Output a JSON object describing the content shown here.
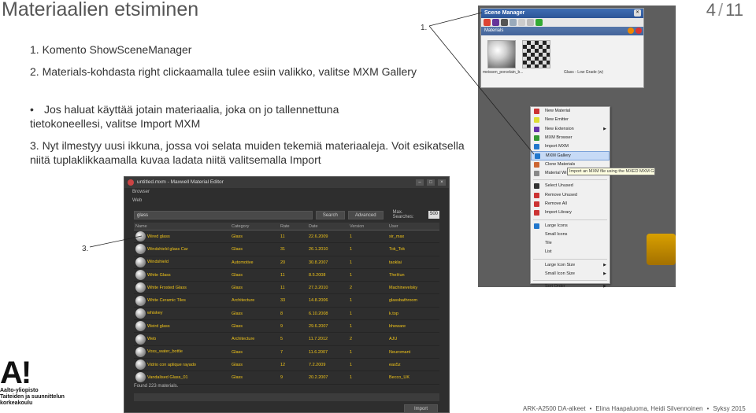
{
  "slide": {
    "title": "Materiaalien etsiminen",
    "page_current": "4",
    "page_total": "11",
    "step1": "1. Komento ShowSceneManager",
    "step2": "2. Materials-kohdasta right clickaamalla tulee esiin valikko, valitse MXM Gallery",
    "bullet": "Jos haluat käyttää jotain materiaalia, joka on jo tallennettuna tietokoneellesi, valitse Import MXM",
    "step3": "3. Nyt ilmestyy uusi ikkuna, jossa voi selata muiden tekemiä materiaaleja. Voit esikatsella niitä tuplaklikkaamalla kuvaa ladata niitä valitsemalla Import",
    "label1": "1.",
    "label3": "3."
  },
  "scene_manager": {
    "title": "Scene Manager",
    "materials_label": "Materials",
    "thumbs": [
      "meissen_porcelain_b...",
      "Glass - Low Grade (w)"
    ]
  },
  "context_menu": {
    "items": [
      {
        "label": "New Material",
        "icon": "new-material-icon",
        "color": "#cc3333"
      },
      {
        "label": "New Emitter",
        "icon": "emitter-icon",
        "color": "#dddd33"
      },
      {
        "label": "New Extension",
        "icon": "extension-icon",
        "color": "#6633aa",
        "submenu": true
      },
      {
        "label": "MXM Browser",
        "icon": "browser-icon",
        "color": "#339933"
      },
      {
        "label": "Import MXM",
        "icon": "import-icon",
        "color": "#2277cc"
      },
      {
        "label": "MXM Gallery",
        "icon": "gallery-icon",
        "color": "#2277cc",
        "highlight": true
      },
      {
        "label": "Clone Materials",
        "icon": "clone-icon",
        "color": "#cc6633"
      },
      {
        "label": "Material Wi",
        "icon": "wizard-icon",
        "color": "#888888"
      },
      {
        "sep": true
      },
      {
        "label": "Select Unused",
        "icon": "select-icon",
        "color": "#333333"
      },
      {
        "label": "Remove Unused",
        "icon": "remove-unused-icon",
        "color": "#cc3333"
      },
      {
        "label": "Remove All",
        "icon": "remove-all-icon",
        "color": "#cc3333"
      },
      {
        "label": "Import Library",
        "icon": "library-icon",
        "color": "#cc3333"
      },
      {
        "sep": true
      },
      {
        "label": "Large Icons",
        "icon": "check-icon",
        "color": "#2277cc"
      },
      {
        "label": "Small Icons",
        "icon": "",
        "color": ""
      },
      {
        "label": "Tile",
        "icon": "",
        "color": ""
      },
      {
        "label": "List",
        "icon": "",
        "color": ""
      },
      {
        "sep": true
      },
      {
        "label": "Large Icon Size",
        "icon": "",
        "color": "",
        "submenu": true
      },
      {
        "label": "Small Icon Size",
        "icon": "",
        "color": "",
        "submenu": true
      },
      {
        "sep": true
      },
      {
        "label": "Sort Order",
        "icon": "",
        "color": "",
        "submenu": true
      }
    ],
    "tooltip": "Import an MXM file using the MXED MXM Gallery B"
  },
  "maxwell": {
    "title": "untitled.mxm - Maxwell Material Editor",
    "tab_browser": "Browser",
    "tab_web": "Web",
    "search_value": "glass",
    "search_button": "Search",
    "advanced_button": "Advanced",
    "max_searches_label": "Max. Searches:",
    "max_searches_value": "500",
    "columns": [
      "Name",
      "Category",
      "Rate",
      "Date",
      "Version",
      "User"
    ],
    "rows": [
      [
        "Wired glass",
        "Glass",
        "11",
        "22.6.2009",
        "1",
        "sir_max"
      ],
      [
        "Windshield glass Car",
        "Glass",
        "31",
        "26.1.2010",
        "1",
        "Tok_Tok"
      ],
      [
        "Windshield",
        "Automotive",
        "20",
        "30.8.2007",
        "1",
        "taoklai"
      ],
      [
        "White Glass",
        "Glass",
        "11",
        "8.5.2008",
        "1",
        "TheHun"
      ],
      [
        "White Frosted Glass",
        "Glass",
        "11",
        "27.3.2010",
        "2",
        "Machinevelsky"
      ],
      [
        "White Ceramic Tiles",
        "Architecture",
        "33",
        "14.8.2006",
        "1",
        "glassbathroom"
      ],
      [
        "whiskey",
        "Glass",
        "8",
        "6.10.2008",
        "1",
        "k.top"
      ],
      [
        "Weird glass",
        "Glass",
        "9",
        "29.6.2007",
        "1",
        "bheware"
      ],
      [
        "Web",
        "Architecture",
        "5",
        "11.7.2012",
        "2",
        "AJU"
      ],
      [
        "Voss_water_bottle",
        "Glass",
        "7",
        "11.6.2007",
        "1",
        "Neuromant"
      ],
      [
        "Vidrio con aplique rayado",
        "Glass",
        "12",
        "7.2.2009",
        "1",
        "eas5z"
      ],
      [
        "Vandalised Glass_01",
        "Glass",
        "9",
        "20.2.2007",
        "1",
        "Becco_UK"
      ]
    ],
    "found_text": "Found 223 materials.",
    "import_button": "Import"
  },
  "logo": {
    "mark": "A!",
    "line1": "Aalto-yliopisto",
    "line2": "Taiteiden ja suunnittelun",
    "line3": "korkeakoulu"
  },
  "footer": {
    "course": "ARK-A2500 DA-alkeet",
    "authors": "Elina Haapaluoma, Heidi Silvennoinen",
    "term": "Syksy 2015"
  }
}
